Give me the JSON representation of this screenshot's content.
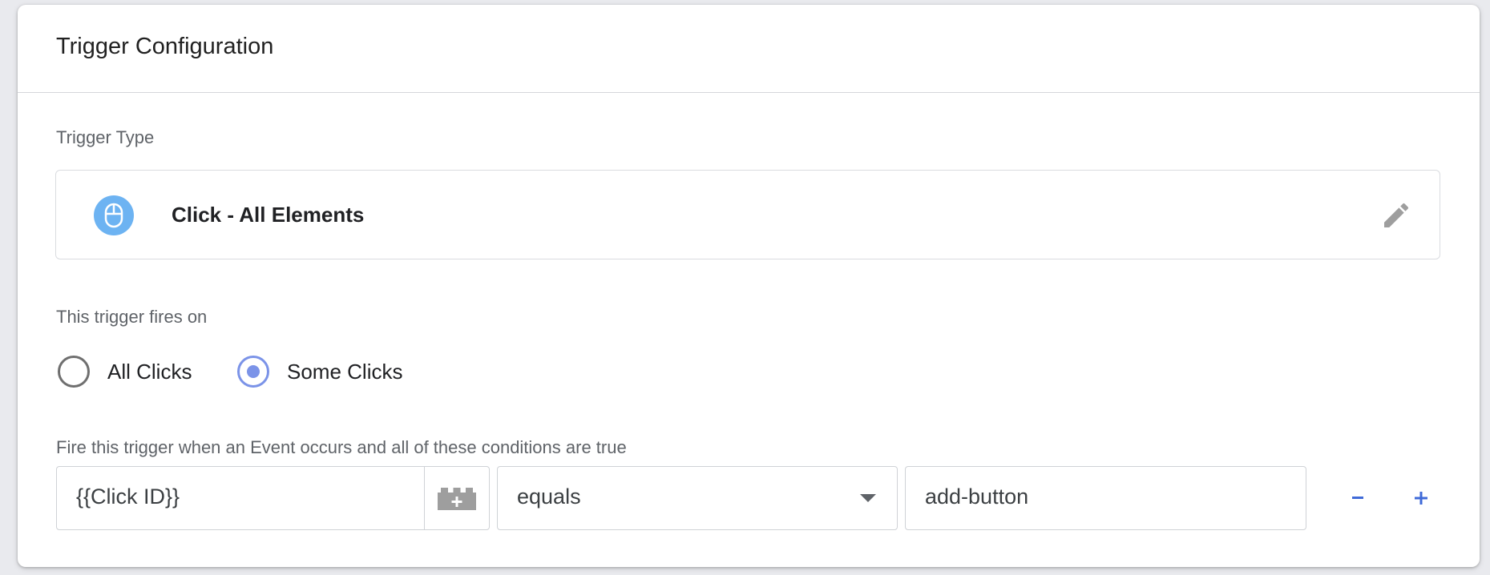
{
  "card": {
    "title": "Trigger Configuration"
  },
  "trigger_type": {
    "section_label": "Trigger Type",
    "name": "Click - All Elements",
    "icon": "mouse-icon",
    "icon_color": "#6db3f2",
    "edit_icon": "pencil-icon"
  },
  "fires_on": {
    "section_label": "This trigger fires on",
    "options": [
      {
        "label": "All Clicks",
        "selected": false
      },
      {
        "label": "Some Clicks",
        "selected": true
      }
    ],
    "accent_color": "#7b93e8"
  },
  "conditions": {
    "section_label": "Fire this trigger when an Event occurs and all of these conditions are true",
    "variable": {
      "value": "{{Click ID}}",
      "picker_icon": "variable-brick-icon"
    },
    "operator": {
      "selected": "equals",
      "icon": "dropdown-arrow-icon"
    },
    "value": {
      "value": "add-button"
    },
    "remove_label": "−",
    "add_label": "+",
    "button_color": "#3f6ad8"
  }
}
